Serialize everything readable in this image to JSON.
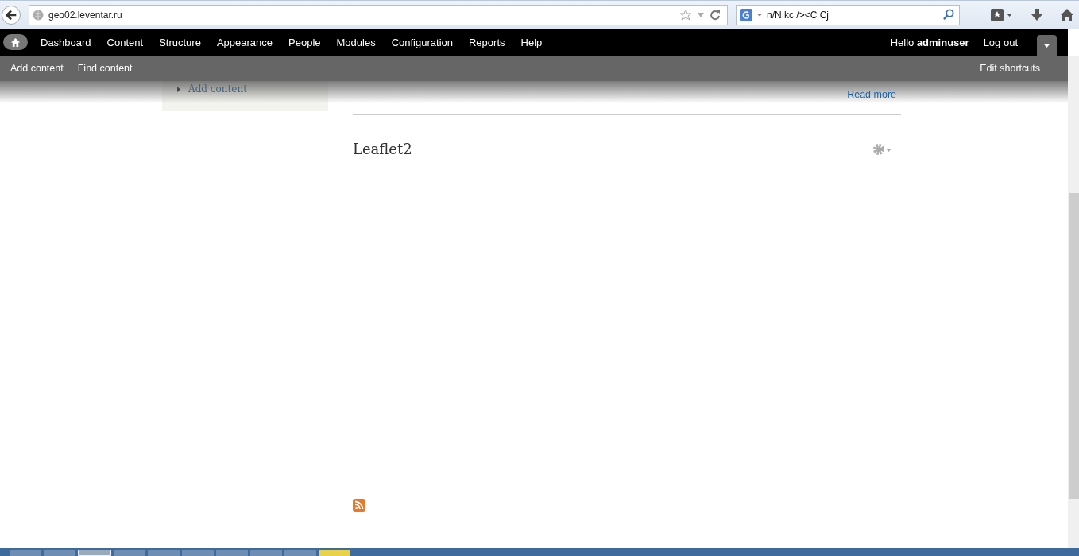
{
  "browser": {
    "url": "geo02.leventar.ru",
    "search": {
      "value": "n/N kc /><C Cj"
    }
  },
  "admin_menu": {
    "items": [
      "Dashboard",
      "Content",
      "Structure",
      "Appearance",
      "People",
      "Modules",
      "Configuration",
      "Reports",
      "Help"
    ],
    "greeting": "Hello **adminuser**",
    "logout": "Log out"
  },
  "shortcuts": {
    "items": [
      "Add content",
      "Find content"
    ],
    "edit": "Edit shortcuts"
  },
  "sidebar": {
    "links": [
      "Add content"
    ]
  },
  "main": {
    "read_more": "Read more",
    "block_title": "Leaflet2"
  }
}
